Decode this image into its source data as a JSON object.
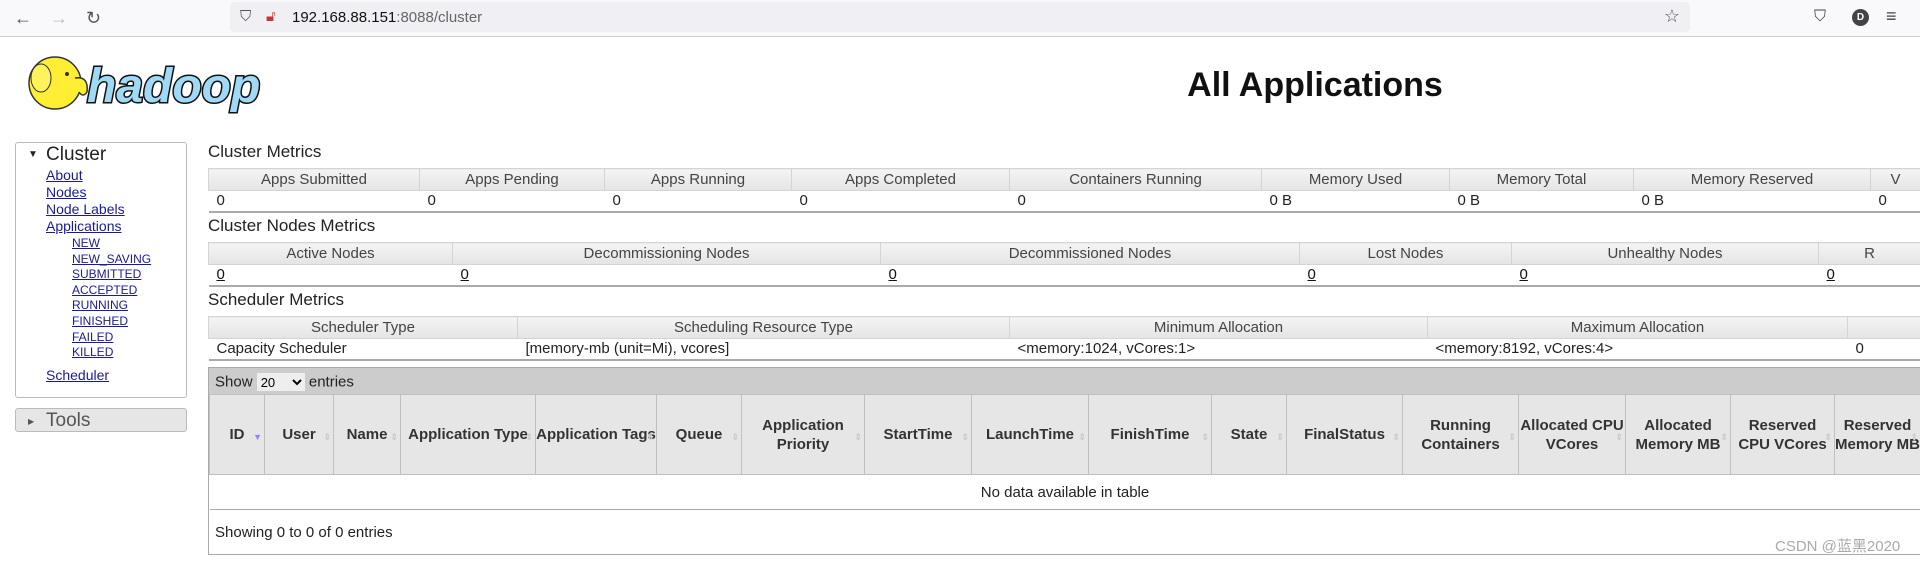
{
  "browser": {
    "url_host": "192.168.88.151",
    "url_path": ":8088/cluster",
    "avatar": "D",
    "icons": [
      "back-icon",
      "forward-icon",
      "reload-icon",
      "shield-icon",
      "insecure-lock-icon",
      "star-icon",
      "pocket-icon",
      "menu-icon"
    ]
  },
  "logo_text": "hadoop",
  "page_title": "All Applications",
  "sidebar": {
    "cluster": "Cluster",
    "links": [
      "About",
      "Nodes",
      "Node Labels",
      "Applications"
    ],
    "states": [
      "NEW",
      "NEW_SAVING",
      "SUBMITTED",
      "ACCEPTED",
      "RUNNING",
      "FINISHED",
      "FAILED",
      "KILLED"
    ],
    "scheduler": "Scheduler",
    "tools": "Tools"
  },
  "cluster_metrics": {
    "title": "Cluster Metrics",
    "headers": [
      "Apps Submitted",
      "Apps Pending",
      "Apps Running",
      "Apps Completed",
      "Containers Running",
      "Memory Used",
      "Memory Total",
      "Memory Reserved",
      "V"
    ],
    "values": [
      "0",
      "0",
      "0",
      "0",
      "0",
      "0 B",
      "0 B",
      "0 B",
      "0"
    ]
  },
  "node_metrics": {
    "title": "Cluster Nodes Metrics",
    "headers": [
      "Active Nodes",
      "Decommissioning Nodes",
      "Decommissioned Nodes",
      "Lost Nodes",
      "Unhealthy Nodes",
      "R"
    ],
    "values": [
      "0",
      "0",
      "0",
      "0",
      "0",
      "0"
    ]
  },
  "scheduler_metrics": {
    "title": "Scheduler Metrics",
    "headers": [
      "Scheduler Type",
      "Scheduling Resource Type",
      "Minimum Allocation",
      "Maximum Allocation",
      ""
    ],
    "values": [
      "Capacity Scheduler",
      "[memory-mb (unit=Mi), vcores]",
      "<memory:1024, vCores:1>",
      "<memory:8192, vCores:4>",
      "0"
    ]
  },
  "apps": {
    "show": "Show",
    "page_size": "20",
    "entries": "entries",
    "columns": [
      "ID",
      "User",
      "Name",
      "Application Type",
      "Application Tags",
      "Queue",
      "Application Priority",
      "StartTime",
      "LaunchTime",
      "FinishTime",
      "State",
      "FinalStatus",
      "Running Containers",
      "Allocated CPU VCores",
      "Allocated Memory MB",
      "Reserved CPU VCores",
      "Reserved Memory MB"
    ],
    "sorted_column": "ID",
    "sort_direction": "descending",
    "empty": "No data available in table",
    "footer": "Showing 0 to 0 of 0 entries"
  },
  "watermark": "CSDN @蓝黑2020"
}
